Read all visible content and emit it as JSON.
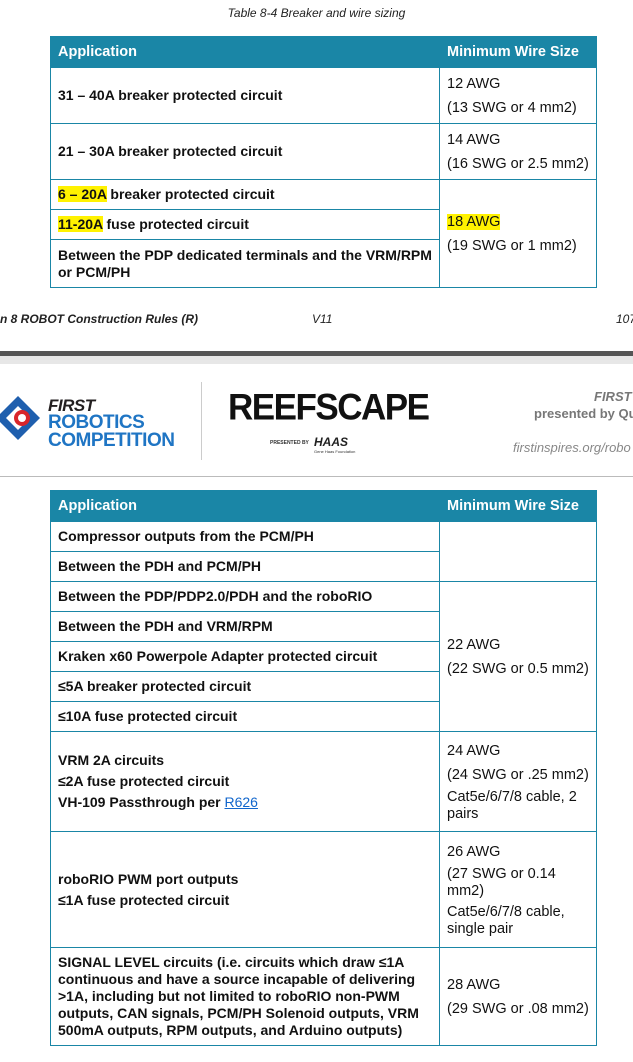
{
  "caption": "Table 8-4 Breaker and wire sizing",
  "table1": {
    "headers": [
      "Application",
      "Minimum Wire Size"
    ],
    "rows": {
      "r1": {
        "app": "31 – 40A breaker protected circuit",
        "size1": "12 AWG",
        "size2": "(13 SWG or 4 mm2)"
      },
      "r2": {
        "app": "21 – 30A breaker protected circuit",
        "size1": "14 AWG",
        "size2": "(16 SWG or 2.5 mm2)"
      },
      "r3": {
        "app_hl": "6 – 20A",
        "app_rest": " breaker protected circuit"
      },
      "r4": {
        "app_hl": "11-20A",
        "app_rest": " fuse protected circuit"
      },
      "r5": {
        "app": "Between the PDP dedicated terminals and the VRM/RPM or PCM/PH"
      },
      "group_size1": "18 AWG",
      "group_size2": "(19 SWG or 1 mm2)"
    }
  },
  "footer": {
    "left": "n 8 ROBOT Construction Rules (R)",
    "center": "V11",
    "right": "107"
  },
  "header": {
    "first": "FIRST",
    "robotics": "ROBOTICS",
    "competition": "COMPETITION",
    "game_title": "REEFSCAPE",
    "presented_by": "PRESENTED BY",
    "sponsor": "HAAS",
    "sponsor_sub": "Gene Haas Foundation",
    "right_title": "FIRST",
    "right_sub": "presented by Qu",
    "right_url": "firstinspires.org/robo"
  },
  "table2": {
    "headers": [
      "Application",
      "Minimum Wire Size"
    ],
    "g1": {
      "apps": [
        "Compressor outputs from the PCM/PH",
        "Between the PDH and PCM/PH"
      ]
    },
    "g2": {
      "apps": [
        "Between the PDP/PDP2.0/PDH and the roboRIO",
        "Between the PDH and VRM/RPM",
        "Kraken x60 Powerpole Adapter protected circuit",
        "≤5A breaker protected circuit",
        "≤10A fuse protected circuit"
      ],
      "size1": "22 AWG",
      "size2": "(22 SWG or 0.5 mm2)"
    },
    "g3": {
      "app1": "VRM 2A circuits",
      "app2": "≤2A fuse protected circuit",
      "app3": "VH-109 Passthrough per ",
      "app3_link": "R626",
      "size1": "24 AWG",
      "size2": "(24 SWG or .25 mm2)",
      "size3": "Cat5e/6/7/8 cable, 2 pairs"
    },
    "g4": {
      "app1": "roboRIO PWM port outputs",
      "app2": "≤1A fuse protected circuit",
      "size1": "26 AWG",
      "size2": "(27 SWG or 0.14 mm2)",
      "size3": "Cat5e/6/7/8 cable, single pair"
    },
    "g5": {
      "app": "SIGNAL LEVEL circuits (i.e. circuits which draw ≤1A continuous and have a source incapable of delivering >1A, including but not limited to roboRIO non-PWM outputs, CAN signals, PCM/PH Solenoid outputs, VRM 500mA outputs, RPM outputs, and Arduino outputs)",
      "size1": "28 AWG",
      "size2": "(29 SWG or .08 mm2)"
    }
  }
}
